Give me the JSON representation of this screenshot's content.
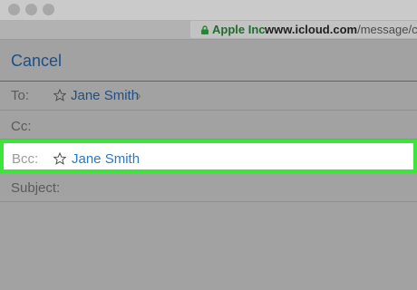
{
  "window": {
    "url_org": "Apple Inc.",
    "url_domain": "www.icloud.com",
    "url_path": "/message/cu"
  },
  "compose": {
    "cancel_label": "Cancel",
    "to_label": "To:",
    "to_recipient": "Jane Smith",
    "to_chevron": "›",
    "cc_label": "Cc:",
    "bcc_label": "Bcc:",
    "bcc_recipient": "Jane Smith",
    "subject_label": "Subject:"
  },
  "colors": {
    "highlight": "#3ce43c",
    "secure_green": "#1f6c2c",
    "link_blue": "#1d4f86"
  },
  "icons": [
    "lock-icon",
    "star-icon"
  ]
}
